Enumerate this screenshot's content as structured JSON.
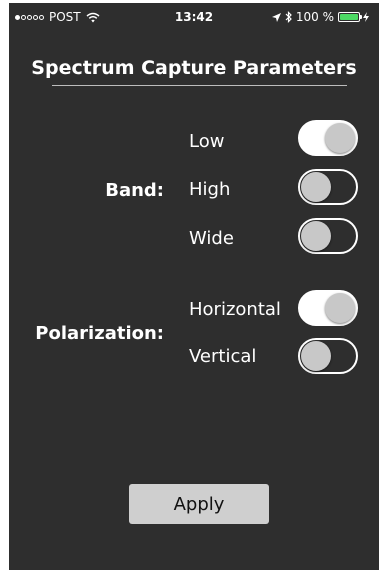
{
  "status_bar": {
    "carrier": "POST",
    "time": "13:42",
    "battery_percent": "100 %",
    "signal_bars_filled": 1,
    "signal_bars_total": 5,
    "icons": [
      "wifi-icon",
      "location-arrow-icon",
      "bluetooth-icon",
      "battery-icon",
      "charging-icon"
    ],
    "battery_color": "#4cd964"
  },
  "header": {
    "title": "Spectrum Capture Parameters"
  },
  "band": {
    "label": "Band:",
    "options": [
      {
        "label": "Low",
        "enabled": true
      },
      {
        "label": "High",
        "enabled": false
      },
      {
        "label": "Wide",
        "enabled": false
      }
    ]
  },
  "polarization": {
    "label": "Polarization:",
    "options": [
      {
        "label": "Horizontal",
        "enabled": true
      },
      {
        "label": "Vertical",
        "enabled": false
      }
    ]
  },
  "apply_button": {
    "label": "Apply"
  },
  "colors": {
    "background": "#2e2e2e",
    "text": "#ffffff",
    "toggle_knob": "#c8c8c8",
    "button_background": "#cfcfcf"
  }
}
